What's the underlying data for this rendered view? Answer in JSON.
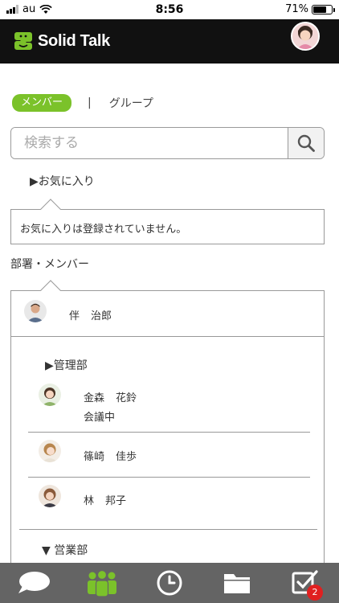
{
  "status_bar": {
    "carrier": "au",
    "time": "8:56",
    "battery_text": "71%",
    "battery_level": 0.71
  },
  "header": {
    "app_name": "Solid Talk",
    "brand_color": "#7bc22a"
  },
  "tabs": {
    "members": "メンバー",
    "separator": "|",
    "groups": "グループ"
  },
  "search": {
    "placeholder": "検索する"
  },
  "favorites": {
    "toggle": "▶お気に入り",
    "empty_message": "お気に入りは登録されていません。"
  },
  "departments": {
    "heading": "部署・メンバー",
    "top_member": {
      "last": "伴",
      "first": "治郎"
    },
    "groups": [
      {
        "toggle": "▶管理部",
        "members": [
          {
            "last": "金森",
            "first": "花鈴",
            "status": "会議中"
          },
          {
            "last": "篠崎",
            "first": "佳歩"
          },
          {
            "last": "林",
            "first": "邦子"
          }
        ]
      },
      {
        "toggle": "▼ 営業部"
      }
    ]
  },
  "bottom_nav": {
    "items": [
      "chat-icon",
      "members-icon",
      "history-icon",
      "folder-icon",
      "tasks-icon"
    ],
    "active_color": "#7bc22a",
    "task_badge": "2"
  }
}
